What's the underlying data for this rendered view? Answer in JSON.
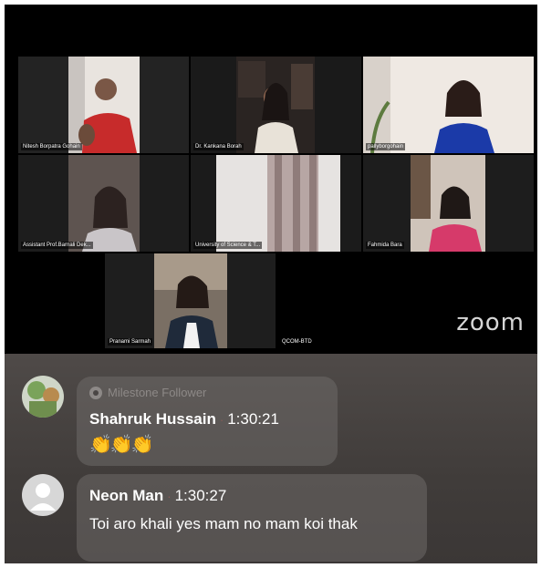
{
  "video": {
    "participants": [
      {
        "name": "Nitesh Borpatra Gohain",
        "active": true
      },
      {
        "name": "Dr. Kankana Borah",
        "active": false
      },
      {
        "name": "pallyborgohain",
        "active": false
      },
      {
        "name": "Assistant Prof.Barnali Dek...",
        "active": false
      },
      {
        "name": "University of Science & T...",
        "active": false
      },
      {
        "name": "Fahmida Bara",
        "active": false
      },
      {
        "name": "Pranami Sarmah",
        "active": false
      },
      {
        "name": "QCOM-BTD",
        "active": false
      }
    ],
    "logo": "zoom"
  },
  "chat": {
    "messages": [
      {
        "badge": "Milestone Follower",
        "author": "Shahruk Hussain",
        "separator": "·",
        "time": "1:30:21",
        "emoji": "👏👏👏"
      },
      {
        "author": "Neon Man",
        "separator": "·",
        "time": "1:30:27",
        "text": "Toi aro khali yes mam no mam koi thak"
      }
    ]
  },
  "colors": {
    "active_speaker": "#7ed957",
    "chat_bg": "#403c3a",
    "badge_gray": "#8d8987"
  }
}
